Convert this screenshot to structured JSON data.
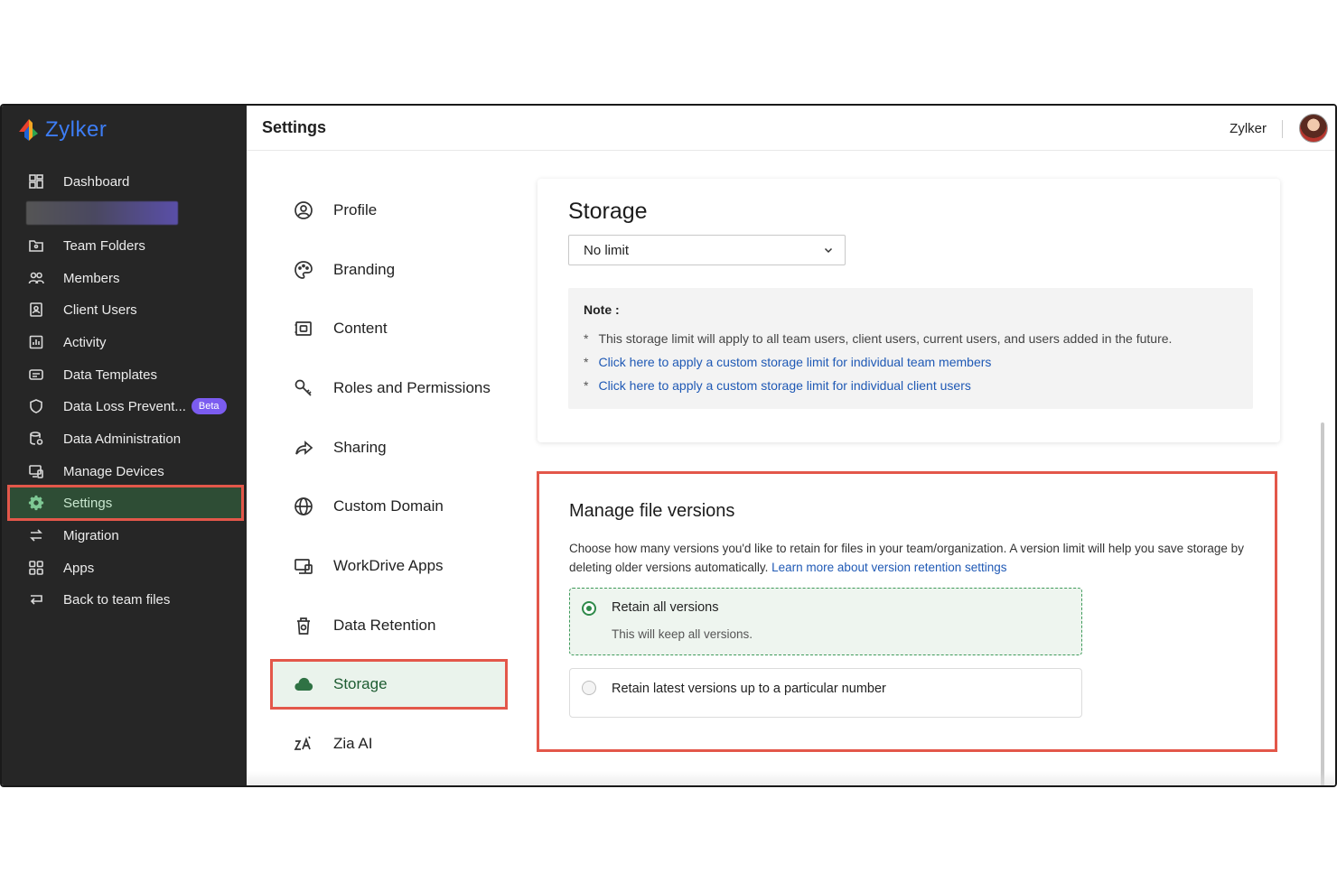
{
  "brand": {
    "name": "Zylker"
  },
  "sidebar": {
    "items": [
      {
        "label": "Dashboard",
        "icon": "dashboard-icon"
      },
      {
        "label": "Team Folders",
        "icon": "team-folders-icon"
      },
      {
        "label": "Members",
        "icon": "members-icon"
      },
      {
        "label": "Client Users",
        "icon": "client-users-icon"
      },
      {
        "label": "Activity",
        "icon": "activity-icon"
      },
      {
        "label": "Data Templates",
        "icon": "data-templates-icon"
      },
      {
        "label": "Data Loss Prevent...",
        "icon": "shield-icon",
        "badge": "Beta"
      },
      {
        "label": "Data Administration",
        "icon": "data-administration-icon"
      },
      {
        "label": "Manage Devices",
        "icon": "devices-icon"
      },
      {
        "label": "Settings",
        "icon": "gear-icon",
        "active": true
      },
      {
        "label": "Migration",
        "icon": "migration-icon"
      },
      {
        "label": "Apps",
        "icon": "apps-icon"
      },
      {
        "label": "Back to team files",
        "icon": "back-arrow-icon"
      }
    ]
  },
  "header": {
    "title": "Settings",
    "org_name": "Zylker"
  },
  "settings_nav": {
    "items": [
      {
        "label": "Profile",
        "icon": "profile-icon"
      },
      {
        "label": "Branding",
        "icon": "palette-icon"
      },
      {
        "label": "Content",
        "icon": "content-icon"
      },
      {
        "label": "Roles and Permissions",
        "icon": "key-icon"
      },
      {
        "label": "Sharing",
        "icon": "share-icon"
      },
      {
        "label": "Custom Domain",
        "icon": "globe-icon"
      },
      {
        "label": "WorkDrive Apps",
        "icon": "workdrive-apps-icon"
      },
      {
        "label": "Data Retention",
        "icon": "trash-icon"
      },
      {
        "label": "Storage",
        "icon": "cloud-icon",
        "active": true
      },
      {
        "label": "Zia AI",
        "icon": "zia-icon"
      }
    ]
  },
  "storage": {
    "title": "Storage",
    "select_value": "No limit",
    "note_title": "Note :",
    "note_lines": [
      "This storage limit will apply to all team users, client users, current users, and users added in the future.",
      "Click here to apply a custom storage limit for individual team members",
      "Click here to apply a custom storage limit for individual client users"
    ]
  },
  "file_versions": {
    "title": "Manage file versions",
    "description": "Choose how many versions you'd like to retain for files in your team/organization. A version limit will help you save storage by deleting older versions automatically.",
    "learn_more": "Learn more about version retention settings",
    "options": [
      {
        "label": "Retain all versions",
        "sub": "This will keep all versions.",
        "selected": true
      },
      {
        "label": "Retain latest versions up to a particular number",
        "selected": false
      }
    ]
  },
  "colors": {
    "accent_green": "#2f8a4a",
    "highlight_red": "#e3574a",
    "link_blue": "#1f59b5",
    "sidebar_bg": "#262626"
  }
}
